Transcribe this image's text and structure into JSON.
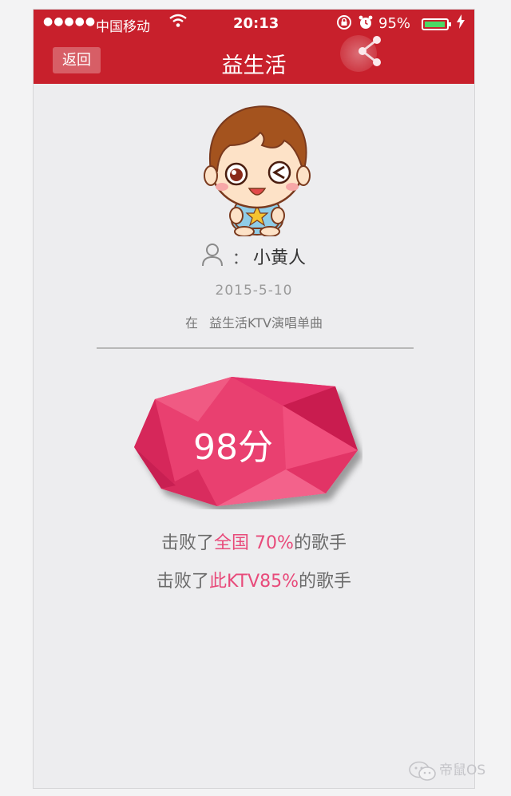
{
  "status_bar": {
    "signal": "●●●●●",
    "carrier": "中国移动",
    "time": "20:13",
    "battery_percent": "95%",
    "battery_level": 0.95,
    "icons": [
      "wifi-icon",
      "rotation-lock-icon",
      "alarm-icon",
      "battery-icon",
      "charging-icon"
    ]
  },
  "nav": {
    "back_label": "返回",
    "title": "益生活",
    "share_icon": "share-icon"
  },
  "profile": {
    "avatar_icon": "cartoon-boy-avatar",
    "user_icon": "user-icon",
    "colon": "：",
    "name": "小黄人",
    "date": "2015-5-10",
    "context_prefix": "在",
    "context_text": "益生活KTV演唱单曲"
  },
  "result": {
    "score": "98分",
    "stat1_prefix": "击败了",
    "stat1_highlight": "全国 70%",
    "stat1_suffix": "的歌手",
    "stat2_prefix": "击败了",
    "stat2_highlight": "此KTV85%",
    "stat2_suffix": "的歌手"
  },
  "colors": {
    "header": "#c8202c",
    "accent": "#e84a7a",
    "gem": "#e93f6f"
  },
  "watermark": {
    "text": "帝鼠OS",
    "icon": "wechat-icon"
  }
}
